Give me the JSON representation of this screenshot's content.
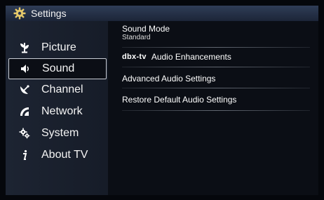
{
  "header": {
    "title": "Settings",
    "icon": "gear-icon"
  },
  "sidebar": {
    "items": [
      {
        "label": "Picture",
        "icon": "picture-icon",
        "selected": false
      },
      {
        "label": "Sound",
        "icon": "speaker-icon",
        "selected": true
      },
      {
        "label": "Channel",
        "icon": "satellite-dish-icon",
        "selected": false
      },
      {
        "label": "Network",
        "icon": "network-icon",
        "selected": false
      },
      {
        "label": "System",
        "icon": "system-gear-icon",
        "selected": false
      },
      {
        "label": "About TV",
        "icon": "info-icon",
        "selected": false
      }
    ]
  },
  "sound_menu": {
    "sound_mode": {
      "label": "Sound Mode",
      "value": "Standard"
    },
    "audio_enhancements": {
      "brand": "dbx-tv",
      "label": "Audio Enhancements"
    },
    "advanced_audio": {
      "label": "Advanced Audio Settings"
    },
    "restore_default": {
      "label": "Restore Default Audio Settings"
    }
  },
  "colors": {
    "titlebar": "#243049",
    "selection_border": "#c8ccd4",
    "background": "#0a0d14"
  }
}
